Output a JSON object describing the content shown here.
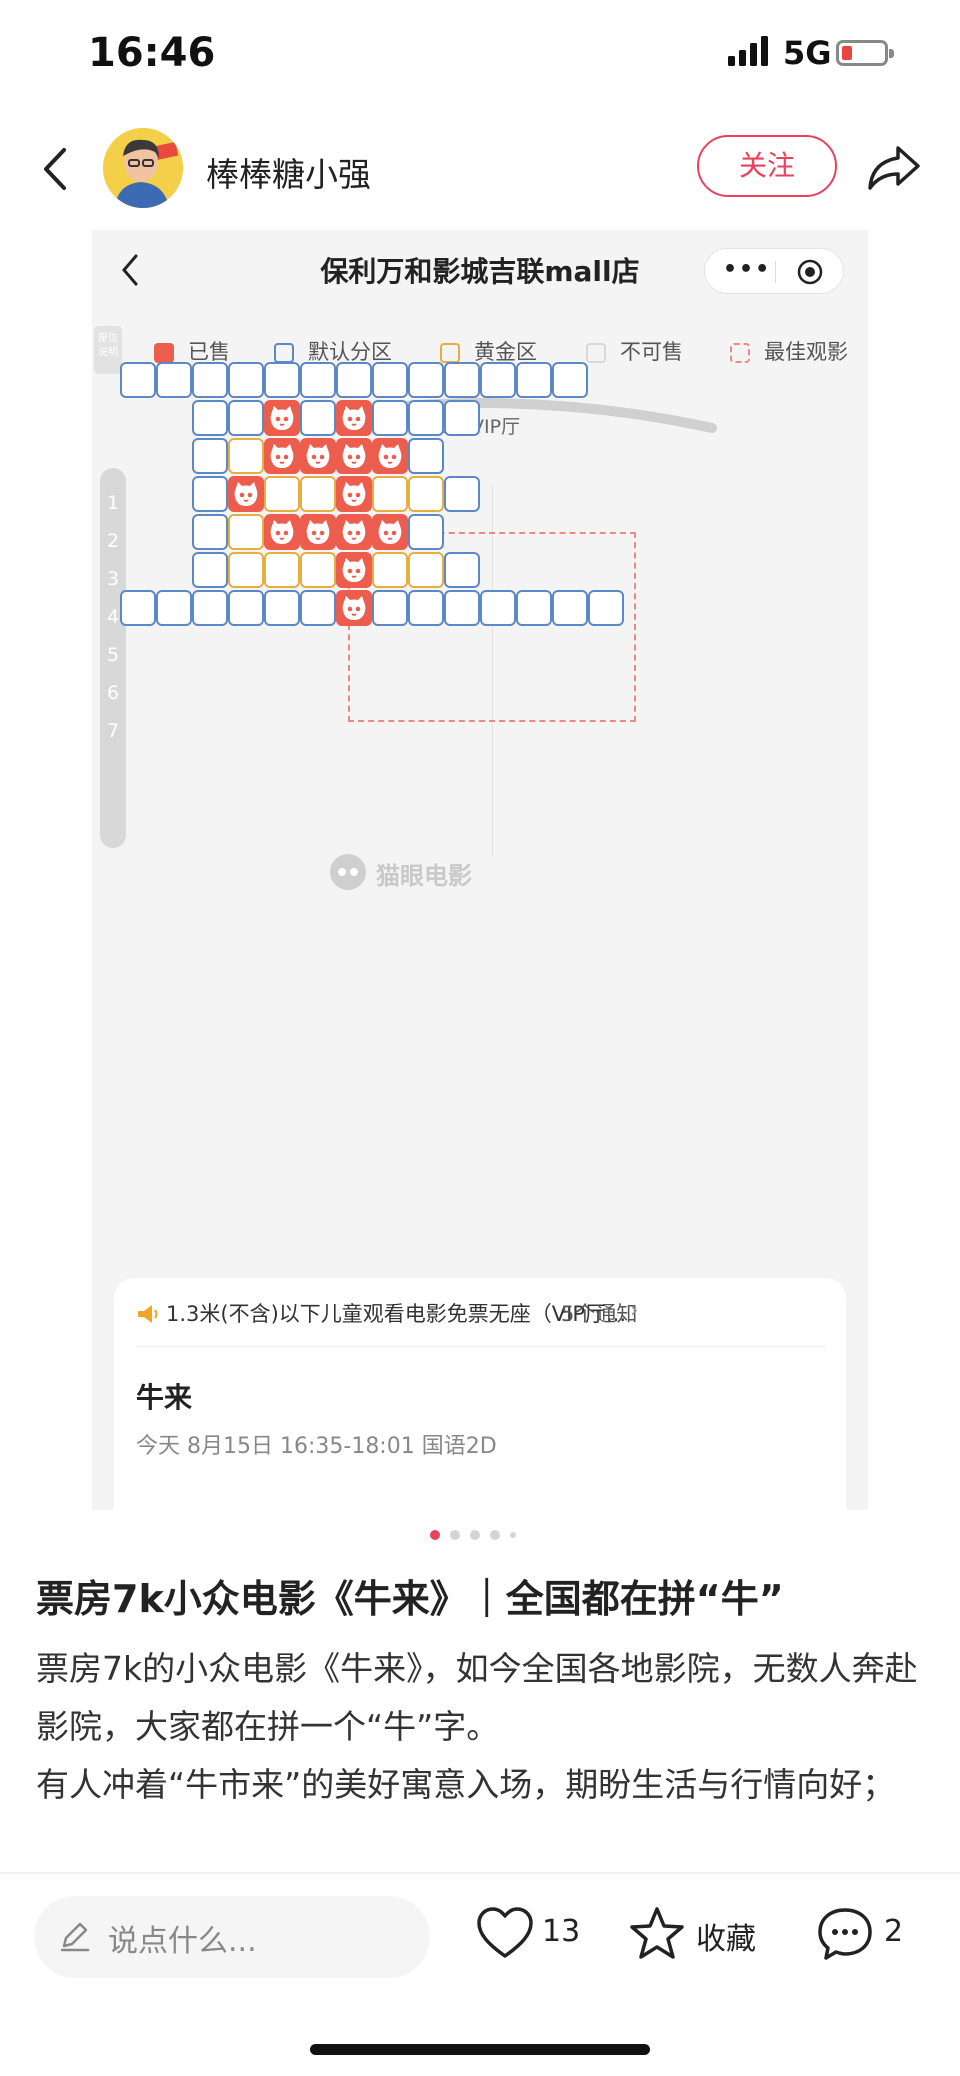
{
  "status_bar": {
    "time": "16:46",
    "network": "5G"
  },
  "header": {
    "author_name": "棒棒糖小强",
    "follow_label": "关注"
  },
  "embedded_screenshot": {
    "cinema_name": "保利万和影城吉联mall店",
    "legend": {
      "help_label": "座位说明",
      "items": [
        {
          "label": "已售"
        },
        {
          "label": "默认分区"
        },
        {
          "label": "黄金区"
        },
        {
          "label": "不可售"
        },
        {
          "label": "最佳观影"
        }
      ]
    },
    "hall_name": "7号VIP厅",
    "row_labels": [
      "1",
      "2",
      "3",
      "4",
      "5",
      "6",
      "7"
    ],
    "seat_map": [
      "aaaaaaaaaaaaa",
      "..aasasaaa...",
      "..agssssa....",
      "..asggsgga...",
      "..agssssa....",
      "..agggsgga...",
      "aaaaaasaaaaaaa"
    ],
    "watermark": "猫眼电影",
    "notice_text": "1.3米(不含)以下儿童观看电影免票无座（VIP厅...",
    "notice_count": "5个通知",
    "movie_title": "牛来",
    "showtime": "今天 8月15日 16:35-18:01 国语2D"
  },
  "image_pager": {
    "total": 5,
    "active_index": 0
  },
  "post": {
    "title": "票房7k小众电影《牛来》｜全国都在拼“牛”",
    "paragraph_1": "票房7k的小众电影《牛来》，如今全国各地影院，无数人奔赴影院，大家都在拼一个“牛”字。",
    "paragraph_2": "有人冲着“牛市来”的美好寓意入场，期盼生活与行情向好；"
  },
  "bottom_bar": {
    "comment_placeholder": "说点什么...",
    "like_count": "13",
    "collect_label": "收藏",
    "comment_count": "2"
  },
  "colors": {
    "accent": "#e9425a",
    "sold": "#ec5d4e",
    "default_zone": "#5c88c6",
    "gold_zone": "#e6ae3e"
  }
}
